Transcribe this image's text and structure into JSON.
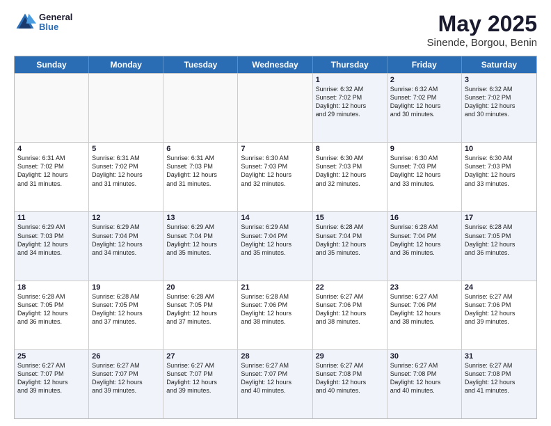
{
  "header": {
    "logo_line1": "General",
    "logo_line2": "Blue",
    "title": "May 2025",
    "subtitle": "Sinende, Borgou, Benin"
  },
  "days": [
    "Sunday",
    "Monday",
    "Tuesday",
    "Wednesday",
    "Thursday",
    "Friday",
    "Saturday"
  ],
  "weeks": [
    [
      {
        "day": "",
        "text": ""
      },
      {
        "day": "",
        "text": ""
      },
      {
        "day": "",
        "text": ""
      },
      {
        "day": "",
        "text": ""
      },
      {
        "day": "1",
        "text": "Sunrise: 6:32 AM\nSunset: 7:02 PM\nDaylight: 12 hours\nand 29 minutes."
      },
      {
        "day": "2",
        "text": "Sunrise: 6:32 AM\nSunset: 7:02 PM\nDaylight: 12 hours\nand 30 minutes."
      },
      {
        "day": "3",
        "text": "Sunrise: 6:32 AM\nSunset: 7:02 PM\nDaylight: 12 hours\nand 30 minutes."
      }
    ],
    [
      {
        "day": "4",
        "text": "Sunrise: 6:31 AM\nSunset: 7:02 PM\nDaylight: 12 hours\nand 31 minutes."
      },
      {
        "day": "5",
        "text": "Sunrise: 6:31 AM\nSunset: 7:02 PM\nDaylight: 12 hours\nand 31 minutes."
      },
      {
        "day": "6",
        "text": "Sunrise: 6:31 AM\nSunset: 7:03 PM\nDaylight: 12 hours\nand 31 minutes."
      },
      {
        "day": "7",
        "text": "Sunrise: 6:30 AM\nSunset: 7:03 PM\nDaylight: 12 hours\nand 32 minutes."
      },
      {
        "day": "8",
        "text": "Sunrise: 6:30 AM\nSunset: 7:03 PM\nDaylight: 12 hours\nand 32 minutes."
      },
      {
        "day": "9",
        "text": "Sunrise: 6:30 AM\nSunset: 7:03 PM\nDaylight: 12 hours\nand 33 minutes."
      },
      {
        "day": "10",
        "text": "Sunrise: 6:30 AM\nSunset: 7:03 PM\nDaylight: 12 hours\nand 33 minutes."
      }
    ],
    [
      {
        "day": "11",
        "text": "Sunrise: 6:29 AM\nSunset: 7:03 PM\nDaylight: 12 hours\nand 34 minutes."
      },
      {
        "day": "12",
        "text": "Sunrise: 6:29 AM\nSunset: 7:04 PM\nDaylight: 12 hours\nand 34 minutes."
      },
      {
        "day": "13",
        "text": "Sunrise: 6:29 AM\nSunset: 7:04 PM\nDaylight: 12 hours\nand 35 minutes."
      },
      {
        "day": "14",
        "text": "Sunrise: 6:29 AM\nSunset: 7:04 PM\nDaylight: 12 hours\nand 35 minutes."
      },
      {
        "day": "15",
        "text": "Sunrise: 6:28 AM\nSunset: 7:04 PM\nDaylight: 12 hours\nand 35 minutes."
      },
      {
        "day": "16",
        "text": "Sunrise: 6:28 AM\nSunset: 7:04 PM\nDaylight: 12 hours\nand 36 minutes."
      },
      {
        "day": "17",
        "text": "Sunrise: 6:28 AM\nSunset: 7:05 PM\nDaylight: 12 hours\nand 36 minutes."
      }
    ],
    [
      {
        "day": "18",
        "text": "Sunrise: 6:28 AM\nSunset: 7:05 PM\nDaylight: 12 hours\nand 36 minutes."
      },
      {
        "day": "19",
        "text": "Sunrise: 6:28 AM\nSunset: 7:05 PM\nDaylight: 12 hours\nand 37 minutes."
      },
      {
        "day": "20",
        "text": "Sunrise: 6:28 AM\nSunset: 7:05 PM\nDaylight: 12 hours\nand 37 minutes."
      },
      {
        "day": "21",
        "text": "Sunrise: 6:28 AM\nSunset: 7:06 PM\nDaylight: 12 hours\nand 38 minutes."
      },
      {
        "day": "22",
        "text": "Sunrise: 6:27 AM\nSunset: 7:06 PM\nDaylight: 12 hours\nand 38 minutes."
      },
      {
        "day": "23",
        "text": "Sunrise: 6:27 AM\nSunset: 7:06 PM\nDaylight: 12 hours\nand 38 minutes."
      },
      {
        "day": "24",
        "text": "Sunrise: 6:27 AM\nSunset: 7:06 PM\nDaylight: 12 hours\nand 39 minutes."
      }
    ],
    [
      {
        "day": "25",
        "text": "Sunrise: 6:27 AM\nSunset: 7:07 PM\nDaylight: 12 hours\nand 39 minutes."
      },
      {
        "day": "26",
        "text": "Sunrise: 6:27 AM\nSunset: 7:07 PM\nDaylight: 12 hours\nand 39 minutes."
      },
      {
        "day": "27",
        "text": "Sunrise: 6:27 AM\nSunset: 7:07 PM\nDaylight: 12 hours\nand 39 minutes."
      },
      {
        "day": "28",
        "text": "Sunrise: 6:27 AM\nSunset: 7:07 PM\nDaylight: 12 hours\nand 40 minutes."
      },
      {
        "day": "29",
        "text": "Sunrise: 6:27 AM\nSunset: 7:08 PM\nDaylight: 12 hours\nand 40 minutes."
      },
      {
        "day": "30",
        "text": "Sunrise: 6:27 AM\nSunset: 7:08 PM\nDaylight: 12 hours\nand 40 minutes."
      },
      {
        "day": "31",
        "text": "Sunrise: 6:27 AM\nSunset: 7:08 PM\nDaylight: 12 hours\nand 41 minutes."
      }
    ]
  ],
  "alt_weeks": [
    0,
    2,
    4
  ]
}
